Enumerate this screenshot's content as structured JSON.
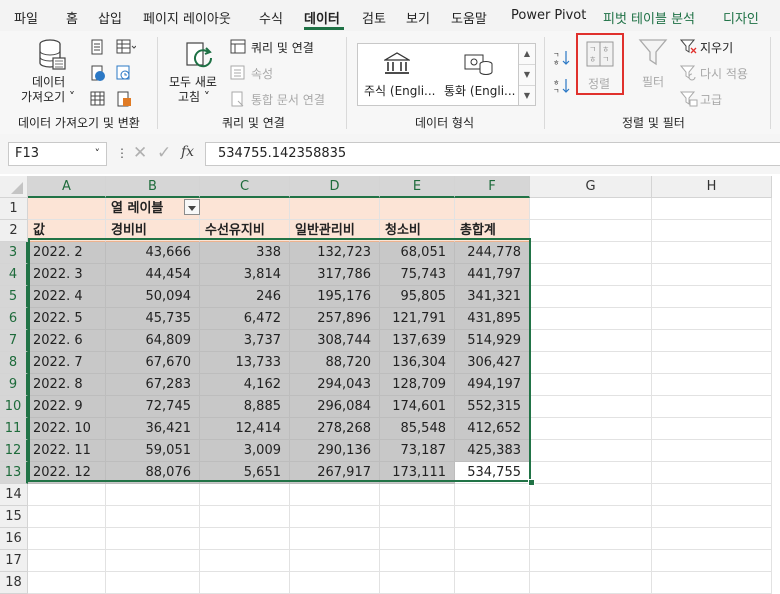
{
  "menu": {
    "items": [
      {
        "label": "파일",
        "name": "menu-file"
      },
      {
        "label": "홈",
        "name": "menu-home"
      },
      {
        "label": "삽입",
        "name": "menu-insert"
      },
      {
        "label": "페이지 레이아웃",
        "name": "menu-page-layout"
      },
      {
        "label": "수식",
        "name": "menu-formulas"
      },
      {
        "label": "데이터",
        "name": "menu-data",
        "active": true
      },
      {
        "label": "검토",
        "name": "menu-review"
      },
      {
        "label": "보기",
        "name": "menu-view"
      },
      {
        "label": "도움말",
        "name": "menu-help"
      },
      {
        "label": "Power Pivot",
        "name": "menu-power-pivot"
      },
      {
        "label": "피벗 테이블 분석",
        "name": "menu-pivot-analyze",
        "accent": true
      },
      {
        "label": "디자인",
        "name": "menu-design",
        "accent": true
      }
    ],
    "accent_color": "#1e7145"
  },
  "ribbon": {
    "get_data": {
      "line1": "데이터",
      "line2": "가져오기"
    },
    "group_get_transform": "데이터 가져오기 및 변환",
    "refresh_all": {
      "line1": "모두 새로",
      "line2": "고침"
    },
    "queries_connections": "쿼리 및 연결",
    "properties": "속성",
    "edit_links": "통합 문서 연결",
    "group_queries": "쿼리 및 연결",
    "stocks": "주식 (Engli...",
    "currencies": "통화 (Engli...",
    "group_data_types": "데이터 형식",
    "sort_label": "정렬",
    "filter_label": "필터",
    "clear_label": "지우기",
    "reapply_label": "다시 적용",
    "advanced_label": "고급",
    "group_sort_filter": "정렬 및 필터",
    "highlight_color": "#e0312d"
  },
  "formula_bar": {
    "name_box": "F13",
    "fx_label": "fx",
    "formula": "534755.142358835"
  },
  "sheet": {
    "columns": [
      "A",
      "B",
      "C",
      "D",
      "E",
      "F",
      "G",
      "H"
    ],
    "rows": [
      "1",
      "2",
      "3",
      "4",
      "5",
      "6",
      "7",
      "8",
      "9",
      "10",
      "11",
      "12",
      "13",
      "14",
      "15",
      "16",
      "17",
      "18"
    ],
    "pivot_col_label": "열 레이블",
    "value_label": "값",
    "headers": [
      "경비비",
      "수선유지비",
      "일반관리비",
      "청소비",
      "총합계"
    ],
    "data": [
      [
        "2022. 2",
        "43,666",
        "338",
        "132,723",
        "68,051",
        "244,778"
      ],
      [
        "2022. 3",
        "44,454",
        "3,814",
        "317,786",
        "75,743",
        "441,797"
      ],
      [
        "2022. 4",
        "50,094",
        "246",
        "195,176",
        "95,805",
        "341,321"
      ],
      [
        "2022. 5",
        "45,735",
        "6,472",
        "257,896",
        "121,791",
        "431,895"
      ],
      [
        "2022. 6",
        "64,809",
        "3,737",
        "308,744",
        "137,639",
        "514,929"
      ],
      [
        "2022. 7",
        "67,670",
        "13,733",
        "88,720",
        "136,304",
        "306,427"
      ],
      [
        "2022. 8",
        "67,283",
        "4,162",
        "294,043",
        "128,709",
        "494,197"
      ],
      [
        "2022. 9",
        "72,745",
        "8,885",
        "296,084",
        "174,601",
        "552,315"
      ],
      [
        "2022. 10",
        "36,421",
        "12,414",
        "278,268",
        "85,548",
        "412,652"
      ],
      [
        "2022. 11",
        "59,051",
        "3,009",
        "290,136",
        "73,187",
        "425,383"
      ],
      [
        "2022. 12",
        "88,076",
        "5,651",
        "267,917",
        "173,111",
        "534,755"
      ]
    ]
  }
}
